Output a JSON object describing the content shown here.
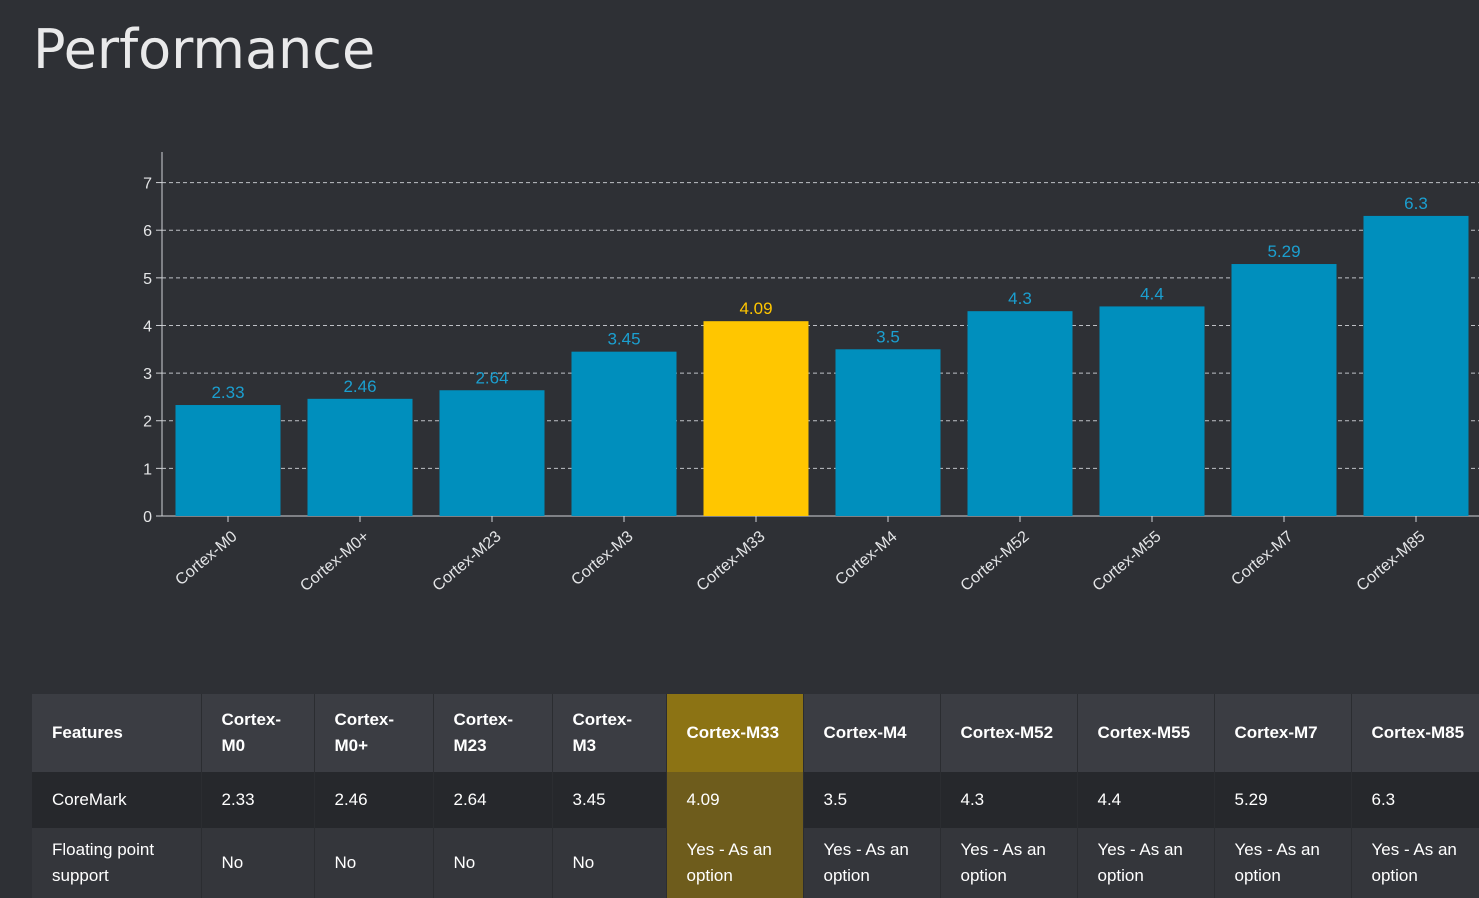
{
  "page": {
    "title": "Performance"
  },
  "colors": {
    "bar": "#008fbd",
    "highlight": "#ffc600",
    "label": "#1b9fd0",
    "highlight_label": "#ffc600"
  },
  "chart_data": {
    "type": "bar",
    "categories": [
      "Cortex-M0",
      "Cortex-M0+",
      "Cortex-M23",
      "Cortex-M3",
      "Cortex-M33",
      "Cortex-M4",
      "Cortex-M52",
      "Cortex-M55",
      "Cortex-M7",
      "Cortex-M85"
    ],
    "values": [
      2.33,
      2.46,
      2.64,
      3.45,
      4.09,
      3.5,
      4.3,
      4.4,
      5.29,
      6.3
    ],
    "value_labels": [
      "2.33",
      "2.46",
      "2.64",
      "3.45",
      "4.09",
      "3.5",
      "4.3",
      "4.4",
      "5.29",
      "6.3"
    ],
    "highlight_index": 4,
    "ylim": [
      0,
      7.6
    ],
    "yticks": [
      0,
      1,
      2,
      3,
      4,
      5,
      6,
      7
    ],
    "grid": "dashed horizontal",
    "legend": "none"
  },
  "table": {
    "headers": [
      "Features",
      "Cortex-M0",
      "Cortex-M0+",
      "Cortex-M23",
      "Cortex-M3",
      "Cortex-M33",
      "Cortex-M4",
      "Cortex-M52",
      "Cortex-M55",
      "Cortex-M7",
      "Cortex-M85"
    ],
    "rows": [
      [
        "CoreMark",
        "2.33",
        "2.46",
        "2.64",
        "3.45",
        "4.09",
        "3.5",
        "4.3",
        "4.4",
        "5.29",
        "6.3"
      ],
      [
        "Floating point support",
        "No",
        "No",
        "No",
        "No",
        "Yes - As an option",
        "Yes - As an option",
        "Yes - As an option",
        "Yes - As an option",
        "Yes - As an option",
        "Yes - As an option"
      ]
    ],
    "highlight_col": 5
  }
}
